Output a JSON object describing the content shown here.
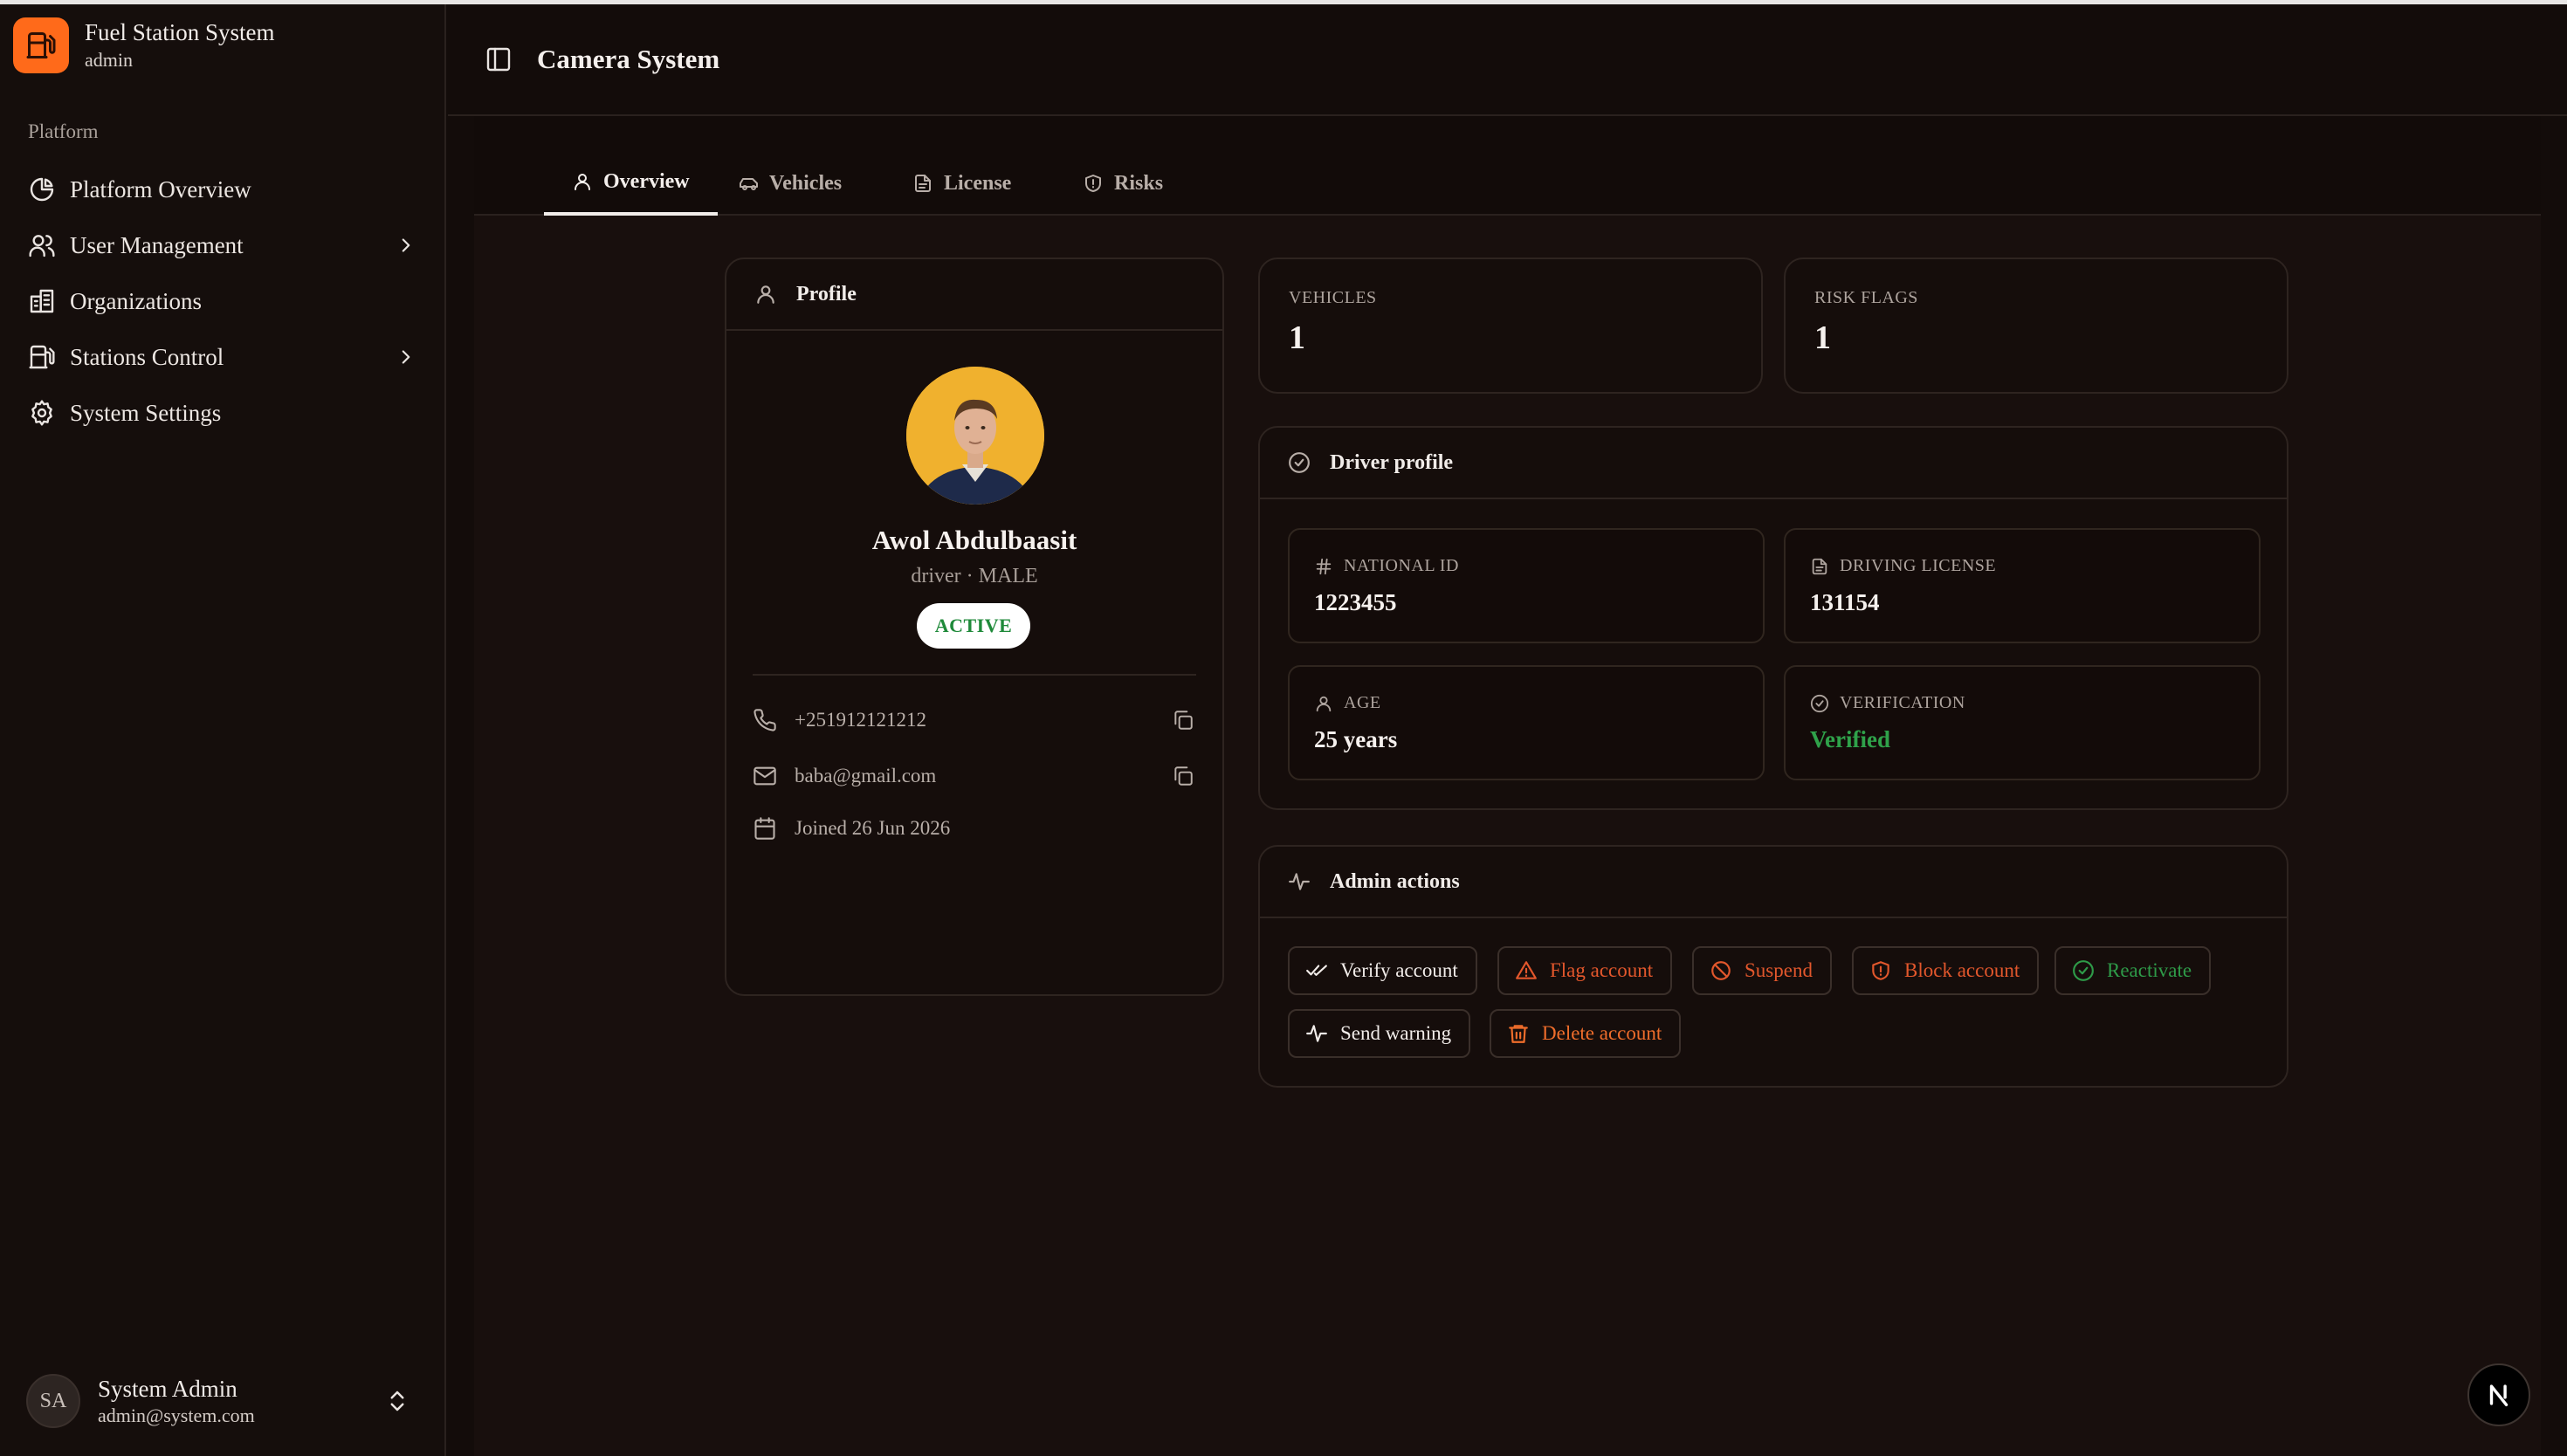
{
  "app": {
    "title": "Fuel Station System",
    "role": "admin",
    "section_label": "Platform"
  },
  "sidebar": {
    "items": [
      {
        "label": "Platform Overview",
        "icon": "pie-chart-icon"
      },
      {
        "label": "User Management",
        "icon": "users-icon",
        "expandable": true
      },
      {
        "label": "Organizations",
        "icon": "building-icon"
      },
      {
        "label": "Stations Control",
        "icon": "fuel-pump-icon",
        "expandable": true
      },
      {
        "label": "System Settings",
        "icon": "gear-icon"
      }
    ],
    "user": {
      "initials": "SA",
      "name": "System Admin",
      "email": "admin@system.com"
    }
  },
  "header": {
    "title": "Camera System"
  },
  "tabs": [
    {
      "label": "Overview",
      "icon": "user-icon",
      "active": true
    },
    {
      "label": "Vehicles",
      "icon": "car-icon",
      "active": false
    },
    {
      "label": "License",
      "icon": "file-icon",
      "active": false
    },
    {
      "label": "Risks",
      "icon": "shield-icon",
      "active": false
    }
  ],
  "profile": {
    "heading": "Profile",
    "name": "Awol Abdulbaasit",
    "role_gender": "driver · MALE",
    "status": "ACTIVE",
    "phone": "+251912121212",
    "email": "baba@gmail.com",
    "joined": "Joined 26 Jun 2026"
  },
  "stats": {
    "vehicles_label": "VEHICLES",
    "vehicles_value": "1",
    "risk_label": "RISK FLAGS",
    "risk_value": "1"
  },
  "driver": {
    "heading": "Driver profile",
    "national_id_label": "NATIONAL ID",
    "national_id": "1223455",
    "license_label": "DRIVING LICENSE",
    "license": "131154",
    "age_label": "AGE",
    "age": "25 years",
    "verification_label": "VERIFICATION",
    "verification": "Verified"
  },
  "admin": {
    "heading": "Admin actions",
    "verify": "Verify account",
    "flag": "Flag account",
    "suspend": "Suspend",
    "block": "Block account",
    "reactivate": "Reactivate",
    "warning": "Send warning",
    "delete": "Delete account"
  },
  "colors": {
    "accent": "#ff6a1a",
    "success": "#2fa24a",
    "danger": "#e2572c"
  }
}
